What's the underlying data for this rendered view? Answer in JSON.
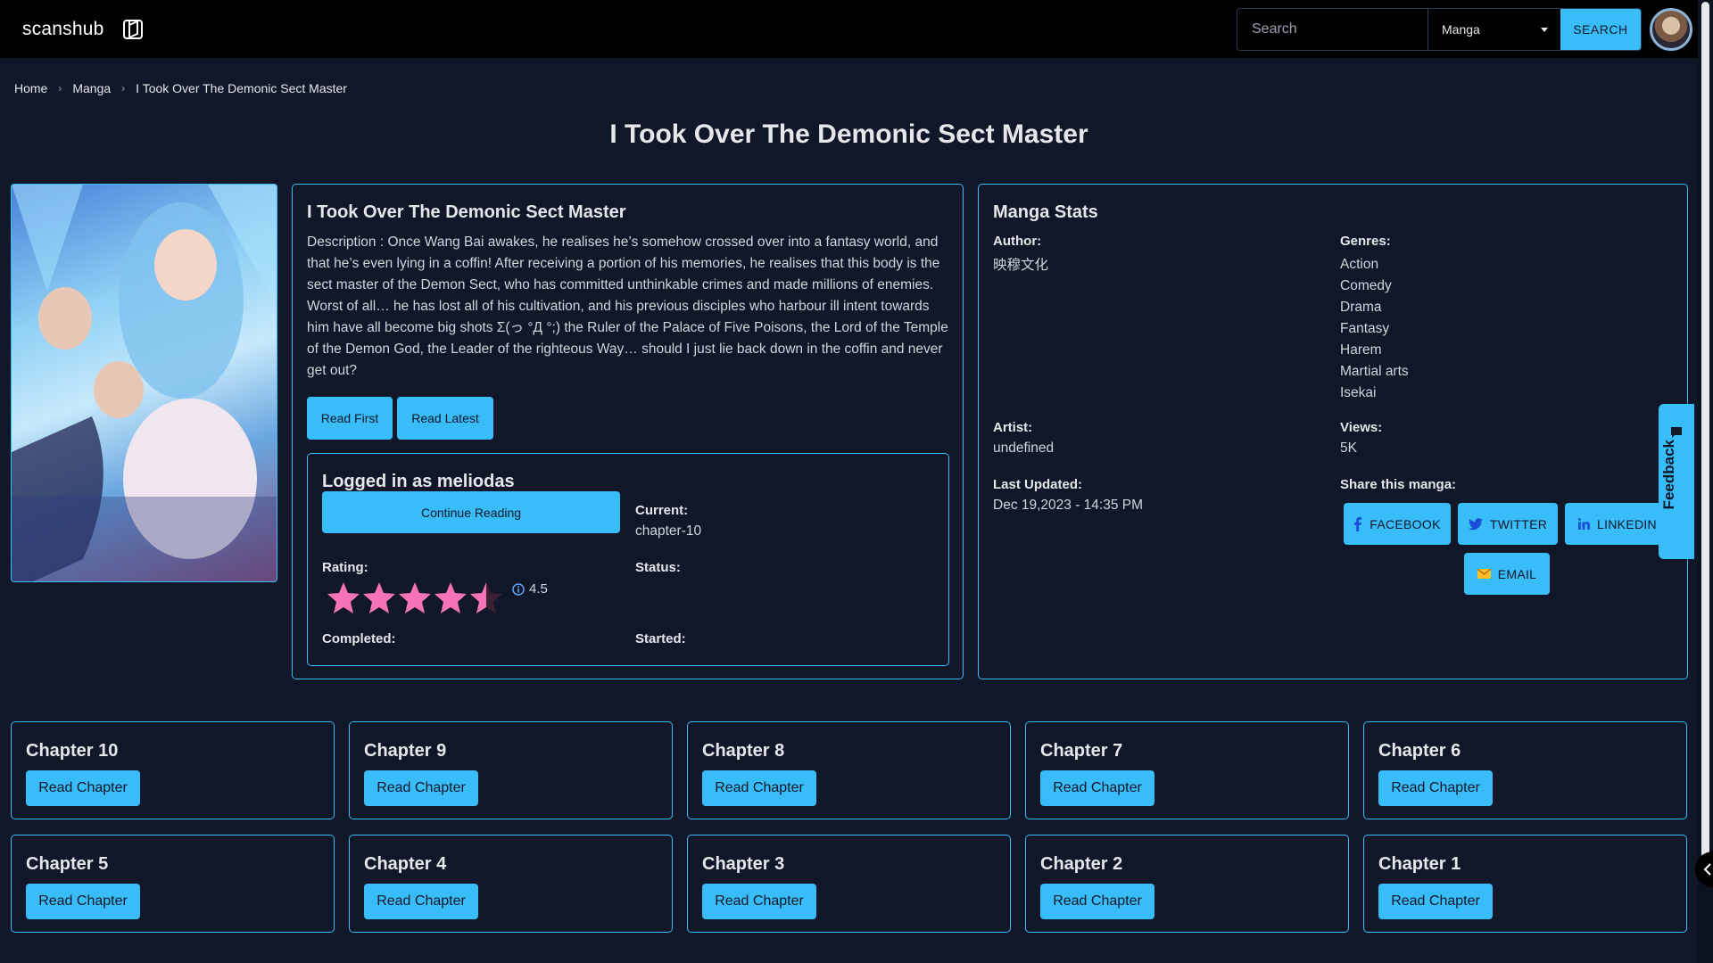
{
  "header": {
    "brand": "scanshub",
    "search_placeholder": "Search",
    "type_select": "Manga",
    "search_button": "SEARCH"
  },
  "breadcrumb": [
    "Home",
    "Manga",
    "I Took Over The Demonic Sect Master"
  ],
  "page_title": "I Took Over The Demonic Sect Master",
  "info": {
    "title": "I Took Over The Demonic Sect Master",
    "description": "Description : Once Wang Bai awakes, he realises he’s somehow crossed over into a fantasy world, and that he’s even lying in a coffin! After receiving a portion of his memories, he realises that this body is the sect master of the Demon Sect, who has committed unthinkable crimes and made millions of enemies. Worst of all… he has lost all of his cultivation, and his previous disciples who harbour ill intent towards him have all become big shots Σ(っ °Д °;) the Ruler of the Palace of Five Poisons, the Lord of the Temple of the Demon God, the Leader of the righteous Way… should I just lie back down in the coffin and never get out?",
    "read_first": "Read First",
    "read_latest": "Read Latest"
  },
  "user_box": {
    "logged_in": "Logged in as meliodas",
    "continue": "Continue Reading",
    "current_label": "Current:",
    "current_value": "chapter-10",
    "rating_label": "Rating:",
    "rating_value": "4.5",
    "rating_number": 4.5,
    "status_label": "Status:",
    "completed_label": "Completed:",
    "started_label": "Started:"
  },
  "stats": {
    "title": "Manga Stats",
    "author_label": "Author:",
    "author": "映穆文化",
    "genres_label": "Genres:",
    "genres": [
      "Action",
      "Comedy",
      "Drama",
      "Fantasy",
      "Harem",
      "Martial arts",
      "Isekai"
    ],
    "artist_label": "Artist:",
    "artist": "undefined",
    "views_label": "Views:",
    "views": "5K",
    "updated_label": "Last Updated:",
    "updated": "Dec 19,2023 - 14:35 PM",
    "share_label": "Share this manga:",
    "share": {
      "facebook": "FACEBOOK",
      "twitter": "TWITTER",
      "linkedin": "LINKEDIN",
      "email": "EMAIL"
    }
  },
  "feedback": "Feedback",
  "chapters": [
    {
      "title": "Chapter 10",
      "button": "Read Chapter"
    },
    {
      "title": "Chapter 9",
      "button": "Read Chapter"
    },
    {
      "title": "Chapter 8",
      "button": "Read Chapter"
    },
    {
      "title": "Chapter 7",
      "button": "Read Chapter"
    },
    {
      "title": "Chapter 6",
      "button": "Read Chapter"
    },
    {
      "title": "Chapter 5",
      "button": "Read Chapter"
    },
    {
      "title": "Chapter 4",
      "button": "Read Chapter"
    },
    {
      "title": "Chapter 3",
      "button": "Read Chapter"
    },
    {
      "title": "Chapter 2",
      "button": "Read Chapter"
    },
    {
      "title": "Chapter 1",
      "button": "Read Chapter"
    }
  ],
  "colors": {
    "accent": "#38bdf8",
    "background": "#0f1729",
    "star": "#f472b6"
  }
}
